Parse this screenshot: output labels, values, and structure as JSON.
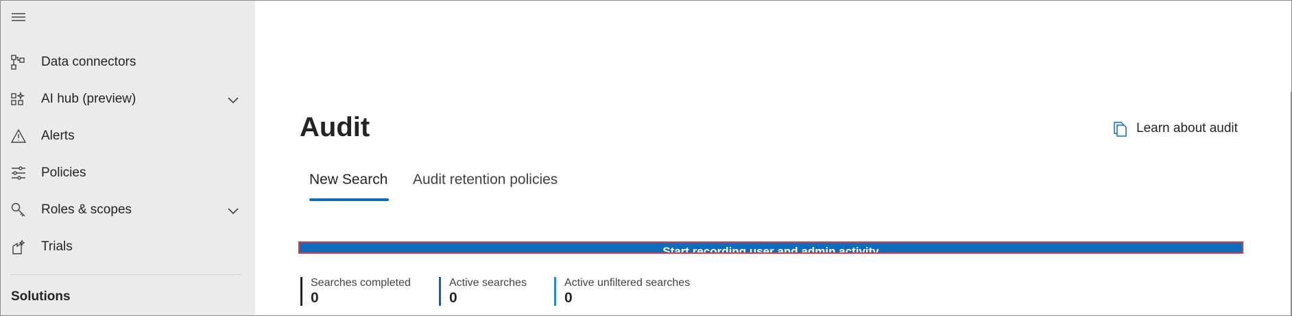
{
  "sidebar": {
    "items": [
      {
        "label": "Data connectors",
        "icon": "data-connectors-icon"
      },
      {
        "label": "AI hub (preview)",
        "icon": "ai-hub-icon",
        "expandable": true
      },
      {
        "label": "Alerts",
        "icon": "alert-triangle-icon"
      },
      {
        "label": "Policies",
        "icon": "policies-sliders-icon"
      },
      {
        "label": "Roles & scopes",
        "icon": "key-icon",
        "expandable": true
      },
      {
        "label": "Trials",
        "icon": "trials-icon"
      }
    ],
    "section_title": "Solutions"
  },
  "main": {
    "title": "Audit",
    "learn_link": "Learn about audit",
    "tabs": [
      {
        "label": "New Search",
        "active": true
      },
      {
        "label": "Audit retention policies",
        "active": false
      }
    ],
    "record_button": "Start recording user and admin activity",
    "stats": [
      {
        "label": "Searches completed",
        "value": "0",
        "color": "#242424"
      },
      {
        "label": "Active searches",
        "value": "0",
        "color": "#2b5c8a"
      },
      {
        "label": "Active unfiltered searches",
        "value": "0",
        "color": "#2886de"
      }
    ]
  },
  "colors": {
    "accent": "#0f6cbd",
    "highlight_border": "#e0383e",
    "sidebar_bg": "#ebebeb"
  }
}
